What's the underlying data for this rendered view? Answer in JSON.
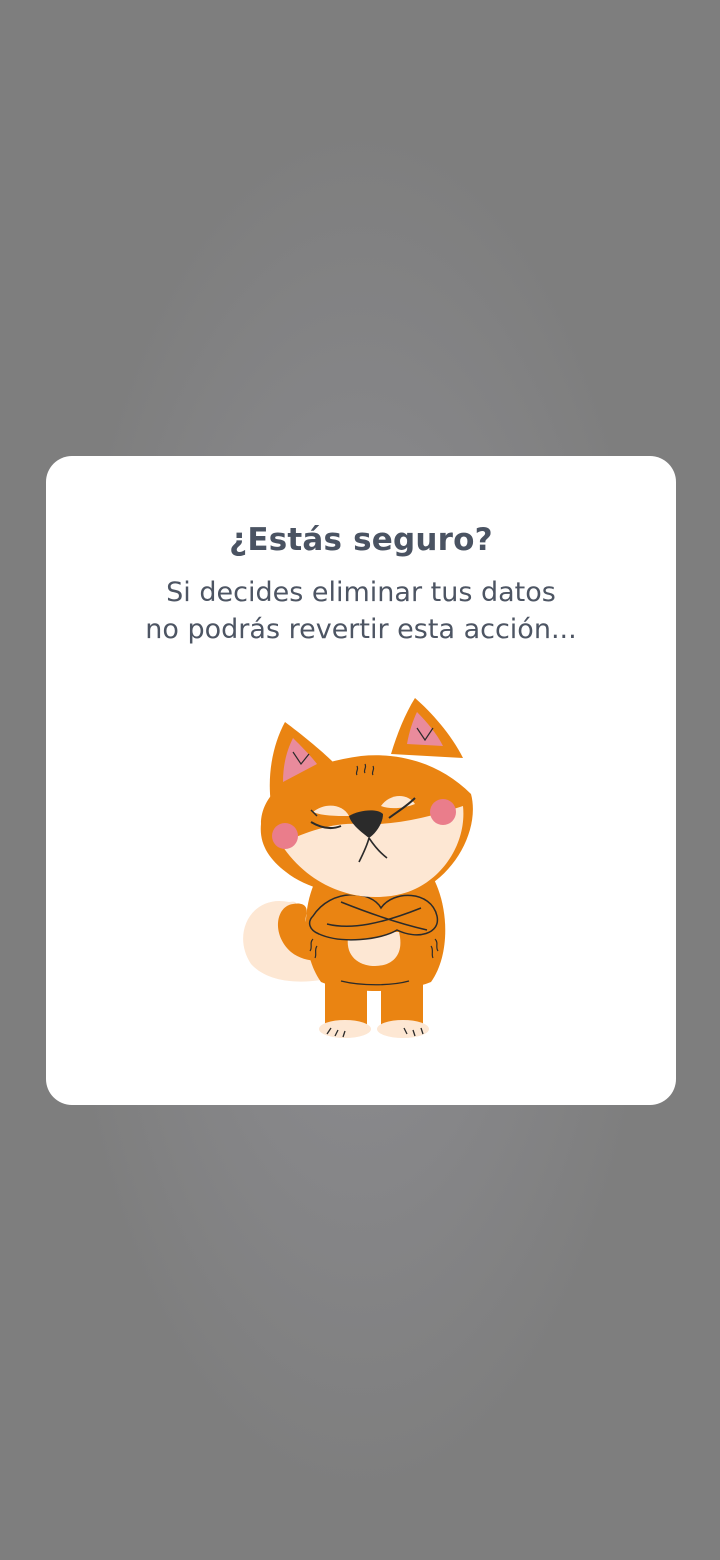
{
  "dialog": {
    "title": "¿Estás seguro?",
    "message_line1": "Si decides eliminar tus datos",
    "message_line2": "no podrás revertir esta acción..."
  },
  "colors": {
    "backdrop": "#7e7e7e",
    "card": "#ffffff",
    "text": "#4a5362",
    "mascot_orange": "#ea8412",
    "mascot_cream": "#fde7d3",
    "blush": "#ea7d8b"
  },
  "illustration": {
    "icon": "shiba-dog-arms-crossed-icon"
  }
}
